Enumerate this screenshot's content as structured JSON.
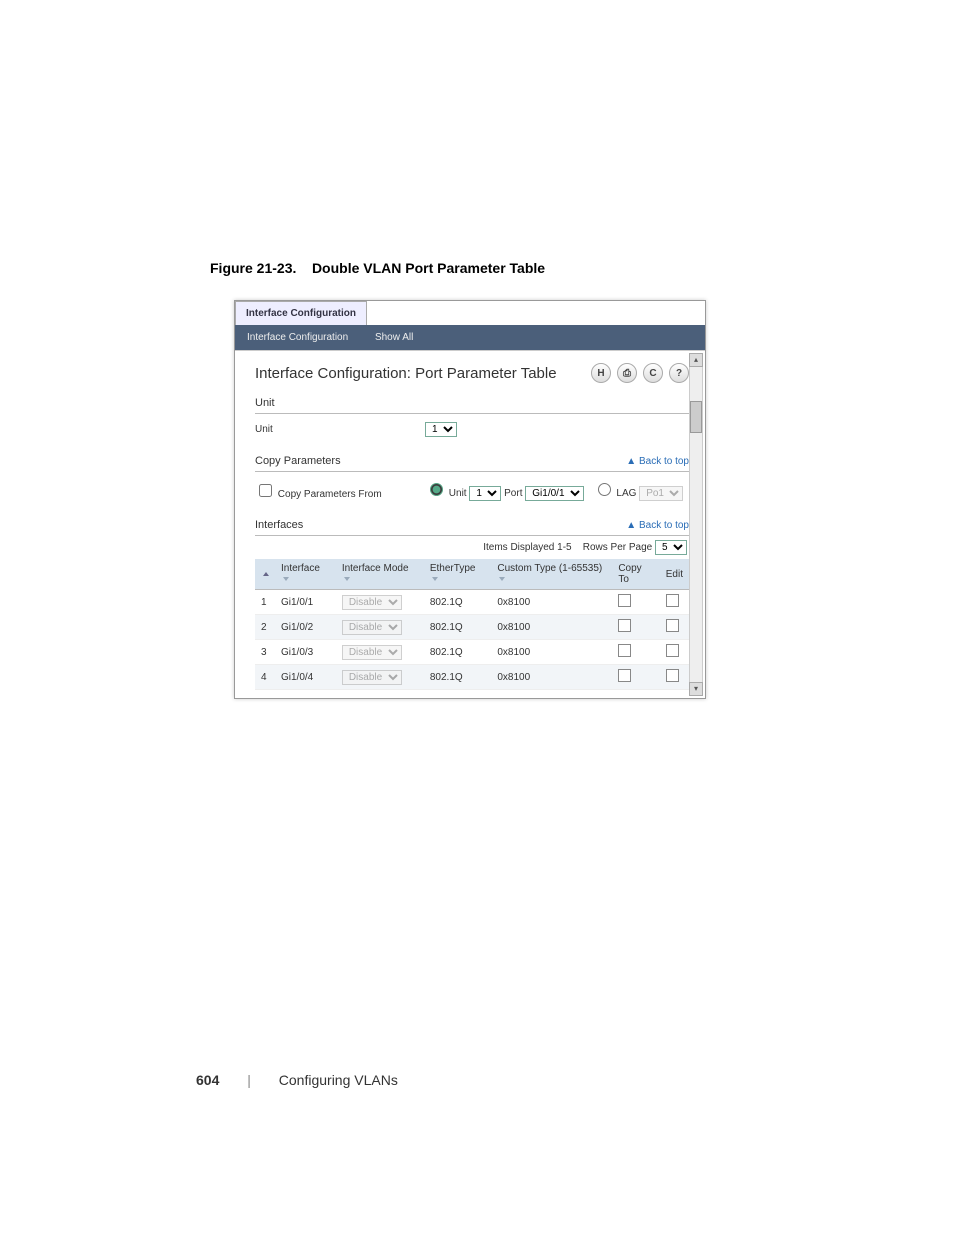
{
  "caption_prefix": "Figure 21-23.",
  "caption_title": "Double VLAN Port Parameter Table",
  "tabs": {
    "active": "Interface Configuration"
  },
  "subtabs": {
    "a": "Interface Configuration",
    "b": "Show All"
  },
  "page_title": "Interface Configuration: Port Parameter Table",
  "toolbar": {
    "save": "H",
    "print": "⎙",
    "refresh": "C",
    "help": "?"
  },
  "sections": {
    "unit_head": "Unit",
    "unit_label": "Unit",
    "unit_value": "1",
    "copy_head": "Copy Parameters",
    "copy_from_label": "Copy Parameters From",
    "unit_radio_label": "Unit",
    "unit_radio_value": "1",
    "port_label": "Port",
    "port_value": "Gi1/0/1",
    "lag_label": "LAG",
    "lag_value": "Po1",
    "interfaces_head": "Interfaces",
    "back_to_top": "▲ Back to top"
  },
  "items_displayed_label": "Items Displayed 1-5",
  "rows_per_page_label": "Rows Per Page",
  "rows_per_page_value": "5",
  "columns": {
    "num": "",
    "interface": "Interface",
    "mode": "Interface Mode",
    "ethertype": "EtherType",
    "custom": "Custom Type (1-65535)",
    "copyto": "Copy To",
    "edit": "Edit"
  },
  "rows": [
    {
      "n": "1",
      "if": "Gi1/0/1",
      "mode": "Disable",
      "et": "802.1Q",
      "ct": "0x8100"
    },
    {
      "n": "2",
      "if": "Gi1/0/2",
      "mode": "Disable",
      "et": "802.1Q",
      "ct": "0x8100"
    },
    {
      "n": "3",
      "if": "Gi1/0/3",
      "mode": "Disable",
      "et": "802.1Q",
      "ct": "0x8100"
    },
    {
      "n": "4",
      "if": "Gi1/0/4",
      "mode": "Disable",
      "et": "802.1Q",
      "ct": "0x8100"
    }
  ],
  "footer": {
    "page_number": "604",
    "chapter": "Configuring VLANs",
    "separator": "|"
  }
}
